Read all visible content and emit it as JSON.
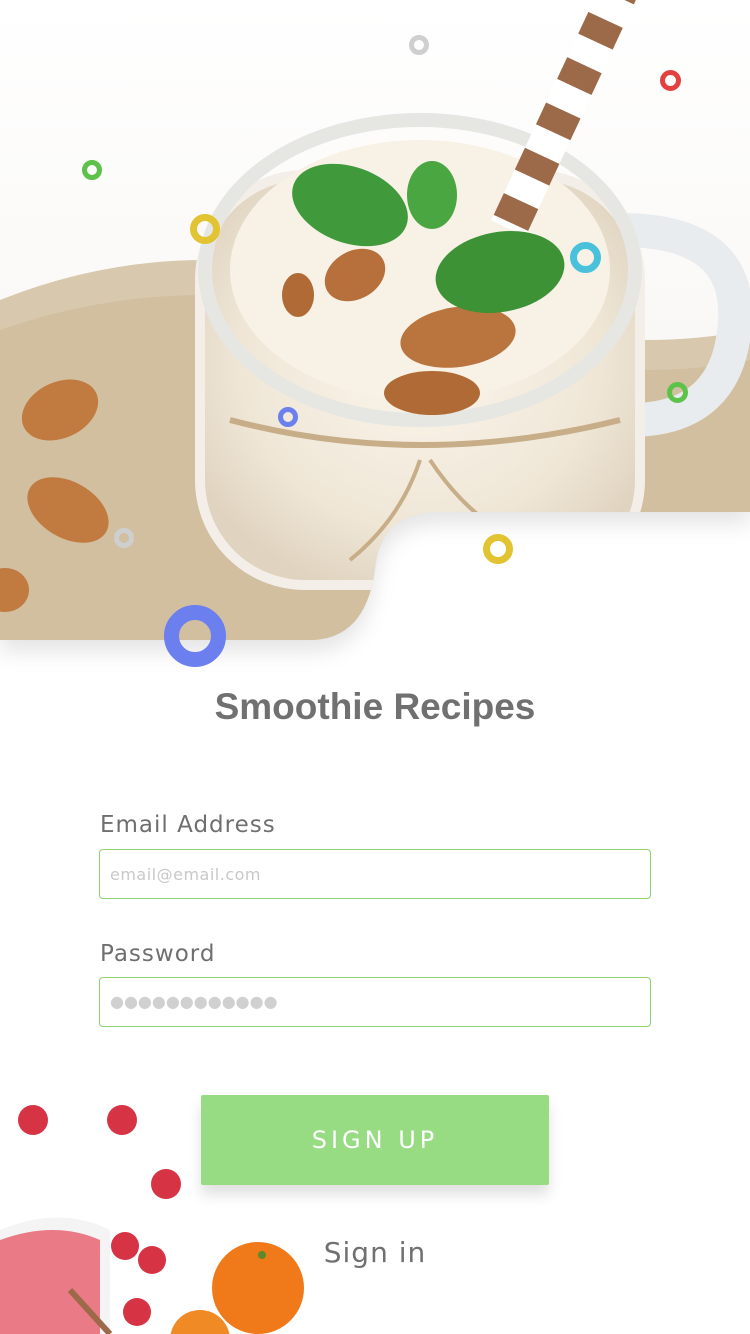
{
  "app": {
    "title": "Smoothie Recipes"
  },
  "form": {
    "email_label": "Email Address",
    "email_placeholder": "email@email.com",
    "password_label": "Password",
    "password_dots": "●●●●●●●●●●●●"
  },
  "actions": {
    "signup_label": "SIGN UP",
    "signin_label": "Sign in"
  },
  "colors": {
    "accent": "#97dc82",
    "field_border": "#8fd16f",
    "text_gray": "#707070"
  },
  "icons": [
    "smoothie-jar-image",
    "almond-image",
    "mint-leaf-image",
    "raspberry-image",
    "orange-image",
    "decorative-ring-icon"
  ]
}
